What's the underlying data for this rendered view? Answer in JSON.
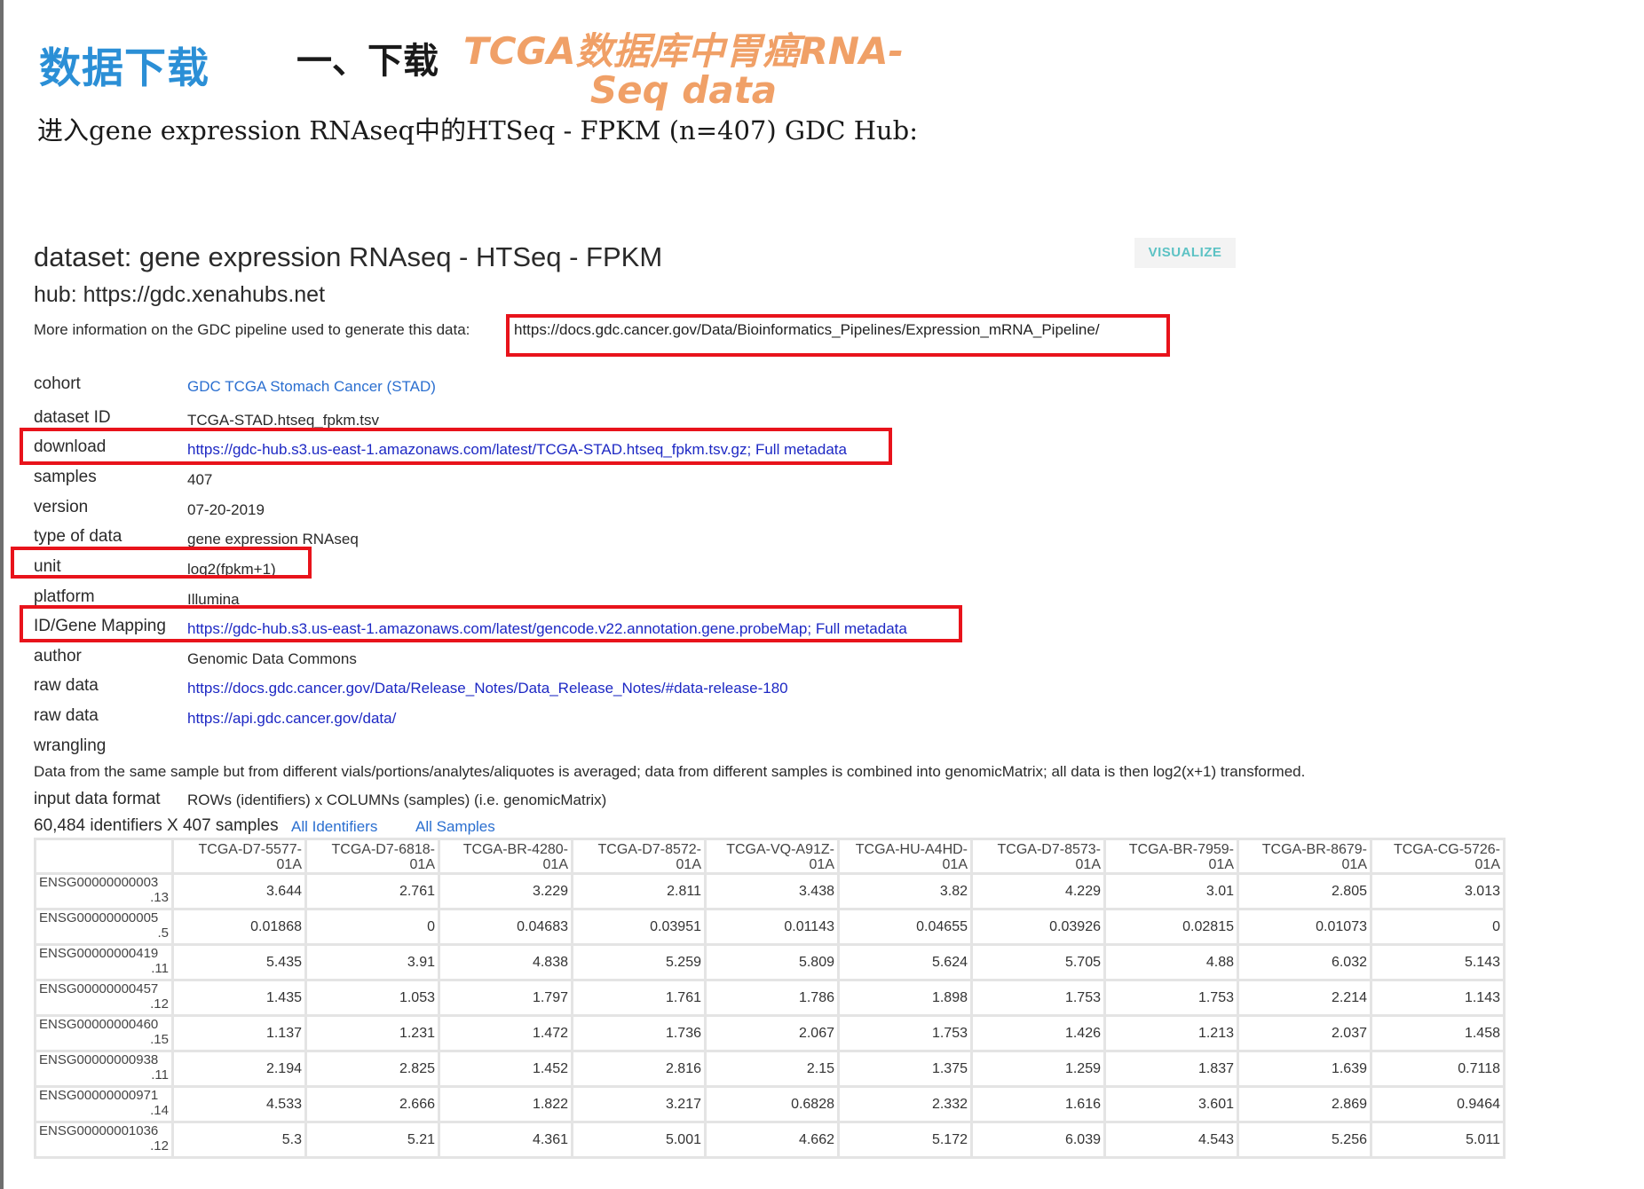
{
  "slide": {
    "heading_main": "数据下载",
    "heading_step": "一、下载",
    "heading_highlight": "TCGA数据库中胃癌RNA-Seq data",
    "intro": "进入gene expression RNAseq中的HTSeq - FPKM (n=407) GDC Hub:"
  },
  "dataset": {
    "title": "dataset: gene expression RNAseq - HTSeq - FPKM",
    "hub": "hub: https://gdc.xenahubs.net",
    "more_info": "More information on the GDC pipeline used to generate this data:",
    "pipeline_link": "https://docs.gdc.cancer.gov/Data/Bioinformatics_Pipelines/Expression_mRNA_Pipeline/",
    "visualize_label": "VISUALIZE"
  },
  "meta": [
    {
      "label": "cohort",
      "value": "GDC TCGA Stomach Cancer (STAD)"
    },
    {
      "label": "dataset ID",
      "value": "TCGA-STAD.htseq_fpkm.tsv"
    },
    {
      "label": "download",
      "value": "https://gdc-hub.s3.us-east-1.amazonaws.com/latest/TCGA-STAD.htseq_fpkm.tsv.gz; Full metadata"
    },
    {
      "label": "samples",
      "value": "407"
    },
    {
      "label": "version",
      "value": "07-20-2019"
    },
    {
      "label": "type of data",
      "value": "gene expression RNAseq"
    },
    {
      "label": "unit",
      "value": "log2(fpkm+1)"
    },
    {
      "label": "platform",
      "value": "Illumina"
    },
    {
      "label": "ID/Gene Mapping",
      "value": "https://gdc-hub.s3.us-east-1.amazonaws.com/latest/gencode.v22.annotation.gene.probeMap; Full metadata"
    },
    {
      "label": "author",
      "value": "Genomic Data Commons"
    },
    {
      "label": "raw data",
      "value": "https://docs.gdc.cancer.gov/Data/Release_Notes/Data_Release_Notes/#data-release-180"
    },
    {
      "label": "raw data",
      "value": "https://api.gdc.cancer.gov/data/"
    },
    {
      "label": "wrangling",
      "value": ""
    }
  ],
  "wrangling_text": "Data from the same sample but from different vials/portions/analytes/aliquotes is averaged; data from different samples is combined into genomicMatrix; all data is then log2(x+1) transformed.",
  "input_format": {
    "label": "input data format",
    "value": "ROWs (identifiers) x COLUMNs (samples) (i.e. genomicMatrix)"
  },
  "identifiers": {
    "count_text": "60,484 identifiers X 407 samples",
    "all_identifiers": "All Identifiers",
    "all_samples": "All Samples"
  },
  "table": {
    "columns": [
      [
        "TCGA-D7-5577-",
        "01A"
      ],
      [
        "TCGA-D7-6818-",
        "01A"
      ],
      [
        "TCGA-BR-4280-",
        "01A"
      ],
      [
        "TCGA-D7-8572-",
        "01A"
      ],
      [
        "TCGA-VQ-A91Z-",
        "01A"
      ],
      [
        "TCGA-HU-A4HD-",
        "01A"
      ],
      [
        "TCGA-D7-8573-",
        "01A"
      ],
      [
        "TCGA-BR-7959-",
        "01A"
      ],
      [
        "TCGA-BR-8679-",
        "01A"
      ],
      [
        "TCGA-CG-5726-",
        "01A"
      ]
    ],
    "rows": [
      {
        "id": [
          "ENSG00000000003",
          ".13"
        ],
        "values": [
          "3.644",
          "2.761",
          "3.229",
          "2.811",
          "3.438",
          "3.82",
          "4.229",
          "3.01",
          "2.805",
          "3.013"
        ]
      },
      {
        "id": [
          "ENSG00000000005",
          ".5"
        ],
        "values": [
          "0.01868",
          "0",
          "0.04683",
          "0.03951",
          "0.01143",
          "0.04655",
          "0.03926",
          "0.02815",
          "0.01073",
          "0"
        ]
      },
      {
        "id": [
          "ENSG00000000419",
          ".11"
        ],
        "values": [
          "5.435",
          "3.91",
          "4.838",
          "5.259",
          "5.809",
          "5.624",
          "5.705",
          "4.88",
          "6.032",
          "5.143"
        ]
      },
      {
        "id": [
          "ENSG00000000457",
          ".12"
        ],
        "values": [
          "1.435",
          "1.053",
          "1.797",
          "1.761",
          "1.786",
          "1.898",
          "1.753",
          "1.753",
          "2.214",
          "1.143"
        ]
      },
      {
        "id": [
          "ENSG00000000460",
          ".15"
        ],
        "values": [
          "1.137",
          "1.231",
          "1.472",
          "1.736",
          "2.067",
          "1.753",
          "1.426",
          "1.213",
          "2.037",
          "1.458"
        ]
      },
      {
        "id": [
          "ENSG00000000938",
          ".11"
        ],
        "values": [
          "2.194",
          "2.825",
          "1.452",
          "2.816",
          "2.15",
          "1.375",
          "1.259",
          "1.837",
          "1.639",
          "0.7118"
        ]
      },
      {
        "id": [
          "ENSG00000000971",
          ".14"
        ],
        "values": [
          "4.533",
          "2.666",
          "1.822",
          "3.217",
          "0.6828",
          "2.332",
          "1.616",
          "3.601",
          "2.869",
          "0.9464"
        ]
      },
      {
        "id": [
          "ENSG00000001036",
          ".12"
        ],
        "values": [
          "5.3",
          "5.21",
          "4.361",
          "5.001",
          "4.662",
          "5.172",
          "6.039",
          "4.543",
          "5.256",
          "5.011"
        ]
      }
    ]
  },
  "colors": {
    "heading_blue": "#2b8fd6",
    "highlight_orange": "#f0a067",
    "link_blue": "#1d28c4",
    "box_red": "#e8131b",
    "visualize_teal": "#5cc2c4"
  }
}
